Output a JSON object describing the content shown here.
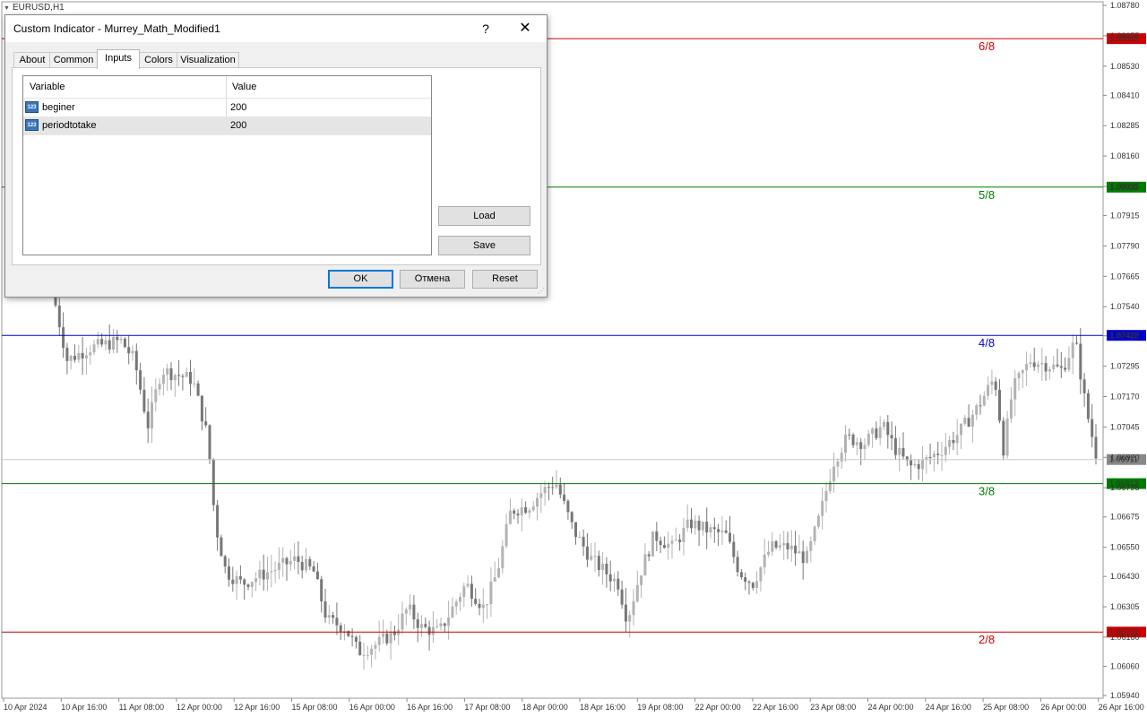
{
  "chart": {
    "symbol": "EURUSD,H1",
    "price_labels": [
      "1.08780",
      "1.08655",
      "1.08530",
      "1.08410",
      "1.08285",
      "1.08160",
      "1.08035",
      "1.07915",
      "1.07790",
      "1.07665",
      "1.07540",
      "1.07420",
      "1.07295",
      "1.07170",
      "1.07045",
      "1.06920",
      "1.06795",
      "1.06675",
      "1.06550",
      "1.06430",
      "1.06305",
      "1.06180",
      "1.06060",
      "1.05940"
    ],
    "date_labels": [
      "10 Apr 2024",
      "10 Apr 16:00",
      "11 Apr 08:00",
      "12 Apr 00:00",
      "12 Apr 16:00",
      "15 Apr 08:00",
      "16 Apr 00:00",
      "16 Apr 16:00",
      "17 Apr 08:00",
      "18 Apr 00:00",
      "18 Apr 16:00",
      "19 Apr 08:00",
      "22 Apr 00:00",
      "22 Apr 16:00",
      "23 Apr 08:00",
      "24 Apr 00:00",
      "24 Apr 16:00",
      "25 Apr 08:00",
      "26 Apr 00:00",
      "26 Apr 16:00"
    ],
    "y_range": [
      1.0594,
      1.0878
    ],
    "levels": [
      {
        "name": "6/8",
        "price": 1.08643,
        "price_text": "1.08643",
        "color": "#cc0000"
      },
      {
        "name": "5/8",
        "price": 1.08032,
        "price_text": "1.08032",
        "color": "#007a00"
      },
      {
        "name": "4/8",
        "price": 1.07422,
        "price_text": "1.07422",
        "color": "#0000cc"
      },
      {
        "name": "3/8",
        "price": 1.06812,
        "price_text": "1.06812",
        "color": "#007a00"
      },
      {
        "name": "2/8",
        "price": 1.06201,
        "price_text": "1.06201",
        "color": "#cc0000"
      }
    ],
    "current_price": {
      "price": 1.06911,
      "text": "1.06911",
      "color": "#888888"
    },
    "candle_color_bull": "#b3b3b3",
    "candle_color_bear": "#777777"
  },
  "dialog": {
    "title": "Custom Indicator - Murrey_Math_Modified1",
    "help_glyph": "?",
    "close_glyph": "✕",
    "tabs": [
      "About",
      "Common",
      "Inputs",
      "Colors",
      "Visualization"
    ],
    "active_tab": "Inputs",
    "columns": {
      "variable": "Variable",
      "value": "Value"
    },
    "rows": [
      {
        "icon": "123",
        "variable": "beginer",
        "value": "200"
      },
      {
        "icon": "123",
        "variable": "periodtotake",
        "value": "200"
      }
    ],
    "load_label": "Load",
    "save_label": "Save",
    "ok_label": "OK",
    "cancel_label": "Отмена",
    "reset_label": "Reset"
  }
}
